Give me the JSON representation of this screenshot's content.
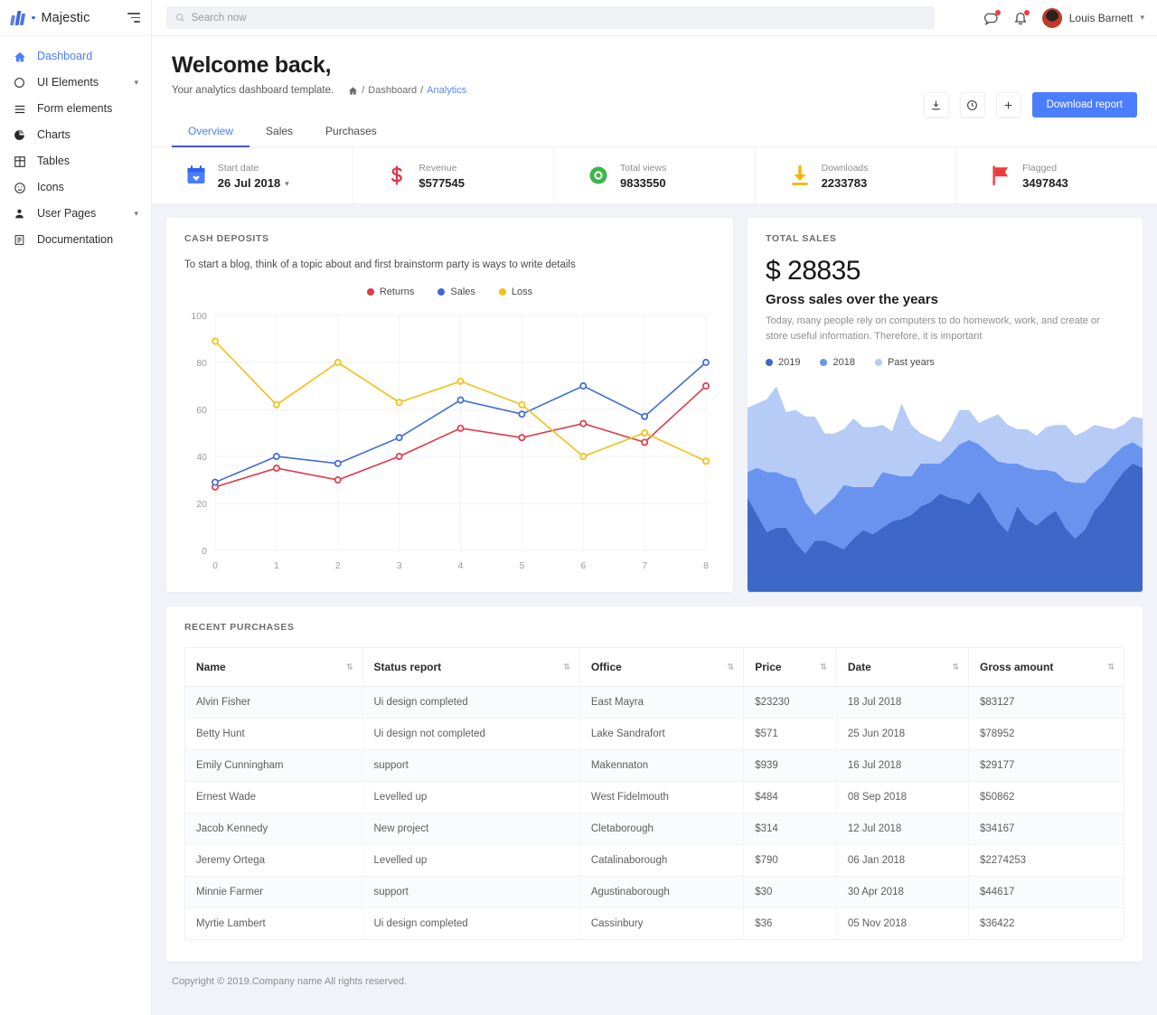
{
  "brand": {
    "name": "Majestic",
    "logo_icon": "majestic-logo",
    "toggle_icon": "menu-toggle-icon"
  },
  "sidebar": {
    "items": [
      {
        "label": "Dashboard",
        "icon": "home-icon",
        "active": true,
        "expandable": false
      },
      {
        "label": "UI Elements",
        "icon": "circle-icon",
        "active": false,
        "expandable": true
      },
      {
        "label": "Form elements",
        "icon": "list-icon",
        "active": false,
        "expandable": false
      },
      {
        "label": "Charts",
        "icon": "pie-chart-icon",
        "active": false,
        "expandable": false
      },
      {
        "label": "Tables",
        "icon": "table-grid-icon",
        "active": false,
        "expandable": false
      },
      {
        "label": "Icons",
        "icon": "smiley-icon",
        "active": false,
        "expandable": false
      },
      {
        "label": "User Pages",
        "icon": "person-icon",
        "active": false,
        "expandable": true
      },
      {
        "label": "Documentation",
        "icon": "document-icon",
        "active": false,
        "expandable": false
      }
    ]
  },
  "topbar": {
    "search": {
      "placeholder": "Search now",
      "value": "",
      "icon": "search-icon"
    },
    "messages_icon": "message-icon",
    "notifications_icon": "bell-icon",
    "badge_color": "#ef3e3e",
    "user": {
      "name": "Louis Barnett",
      "avatar_icon": "avatar",
      "caret_icon": "chevron-down-icon"
    }
  },
  "welcome": {
    "title": "Welcome back,",
    "subtitle": "Your analytics dashboard template.",
    "breadcrumb": {
      "home_icon": "home-icon",
      "items": [
        "Dashboard",
        "Analytics"
      ],
      "sep": "/"
    },
    "actions": {
      "download_icon": "download-icon",
      "history_icon": "clock-icon",
      "add_icon": "plus-icon",
      "primary_label": "Download report",
      "primary_color": "#4a7dff"
    }
  },
  "tabs": [
    {
      "label": "Overview",
      "active": true
    },
    {
      "label": "Sales",
      "active": false
    },
    {
      "label": "Purchases",
      "active": false
    }
  ],
  "stats": [
    {
      "label": "Start date",
      "value": "26 Jul 2018",
      "icon": "calendar-icon",
      "color": "#4a7dff",
      "dropdown": true
    },
    {
      "label": "Revenue",
      "value": "$577545",
      "icon": "dollar-icon",
      "color": "#e0394a",
      "dropdown": false
    },
    {
      "label": "Total views",
      "value": "9833550",
      "icon": "eye-icon",
      "color": "#3cb54a",
      "dropdown": false
    },
    {
      "label": "Downloads",
      "value": "2233783",
      "icon": "download-arrow-icon",
      "color": "#f2b705",
      "dropdown": false
    },
    {
      "label": "Flagged",
      "value": "3497843",
      "icon": "flag-icon",
      "color": "#ee3b3b",
      "dropdown": false
    }
  ],
  "cash_deposits": {
    "title": "CASH DEPOSITS",
    "description": "To start a blog, think of a topic about and first brainstorm party is ways to write details"
  },
  "total_sales": {
    "title": "TOTAL SALES",
    "amount": "$ 28835",
    "heading": "Gross sales over the years",
    "description": "Today, many people rely on computers to do homework, work, and create or store useful information. Therefore, it is important"
  },
  "recent_purchases": {
    "title": "RECENT PURCHASES",
    "columns": [
      "Name",
      "Status report",
      "Office",
      "Price",
      "Date",
      "Gross amount"
    ],
    "rows": [
      [
        "Alvin Fisher",
        "Ui design completed",
        "East Mayra",
        "$23230",
        "18 Jul 2018",
        "$83127"
      ],
      [
        "Betty Hunt",
        "Ui design not completed",
        "Lake Sandrafort",
        "$571",
        "25 Jun 2018",
        "$78952"
      ],
      [
        "Emily Cunningham",
        "support",
        "Makennaton",
        "$939",
        "16 Jul 2018",
        "$29177"
      ],
      [
        "Ernest Wade",
        "Levelled up",
        "West Fidelmouth",
        "$484",
        "08 Sep 2018",
        "$50862"
      ],
      [
        "Jacob Kennedy",
        "New project",
        "Cletaborough",
        "$314",
        "12 Jul 2018",
        "$34167"
      ],
      [
        "Jeremy Ortega",
        "Levelled up",
        "Catalinaborough",
        "$790",
        "06 Jan 2018",
        "$2274253"
      ],
      [
        "Minnie Farmer",
        "support",
        "Agustinaborough",
        "$30",
        "30 Apr 2018",
        "$44617"
      ],
      [
        "Myrtie Lambert",
        "Ui design completed",
        "Cassinbury",
        "$36",
        "05 Nov 2018",
        "$36422"
      ]
    ]
  },
  "footer": {
    "text": "Copyright © 2019.Company name All rights reserved."
  },
  "chart_data": [
    {
      "type": "line",
      "title": "CASH DEPOSITS",
      "x": [
        0,
        1,
        2,
        3,
        4,
        5,
        6,
        7,
        8
      ],
      "xlabel": "",
      "ylabel": "",
      "ylim": [
        0,
        100
      ],
      "yticks": [
        0,
        20,
        40,
        60,
        80,
        100
      ],
      "grid": true,
      "legend_position": "top-center",
      "series": [
        {
          "name": "Returns",
          "color": "#e0394a",
          "values": [
            27,
            35,
            30,
            40,
            52,
            48,
            54,
            46,
            70
          ]
        },
        {
          "name": "Sales",
          "color": "#3f6ad8",
          "values": [
            29,
            40,
            37,
            48,
            64,
            58,
            70,
            57,
            80
          ]
        },
        {
          "name": "Loss",
          "color": "#f2c014",
          "values": [
            89,
            62,
            80,
            63,
            72,
            62,
            40,
            50,
            38
          ]
        }
      ]
    },
    {
      "type": "area",
      "title": "Gross sales over the years",
      "stacked": true,
      "grid": false,
      "legend_position": "top-left",
      "series": [
        {
          "name": "2019",
          "color": "#3d68c9",
          "values": [
            44,
            36,
            28,
            30,
            30,
            23,
            18,
            24,
            24,
            22,
            20,
            25,
            29,
            27,
            30,
            33,
            34,
            36,
            40,
            42,
            46,
            44,
            43,
            41,
            47,
            41,
            33,
            28,
            40,
            34,
            31,
            35,
            38,
            30,
            25,
            29,
            38,
            43,
            50,
            56,
            60,
            58
          ]
        },
        {
          "name": "2018",
          "color": "#6a93f0",
          "values": [
            12,
            22,
            28,
            26,
            24,
            30,
            24,
            12,
            16,
            22,
            30,
            24,
            20,
            22,
            26,
            22,
            20,
            18,
            20,
            18,
            14,
            20,
            26,
            30,
            22,
            24,
            28,
            32,
            20,
            24,
            26,
            22,
            18,
            22,
            26,
            22,
            18,
            16,
            14,
            12,
            10,
            9
          ]
        },
        {
          "name": "Past years",
          "color": "#b6cbf5",
          "values": [
            30,
            30,
            34,
            40,
            30,
            32,
            40,
            46,
            34,
            30,
            26,
            32,
            28,
            28,
            22,
            20,
            34,
            24,
            14,
            12,
            10,
            12,
            16,
            14,
            10,
            16,
            22,
            18,
            16,
            18,
            16,
            20,
            22,
            26,
            22,
            24,
            22,
            18,
            12,
            10,
            12,
            14
          ]
        }
      ]
    }
  ]
}
